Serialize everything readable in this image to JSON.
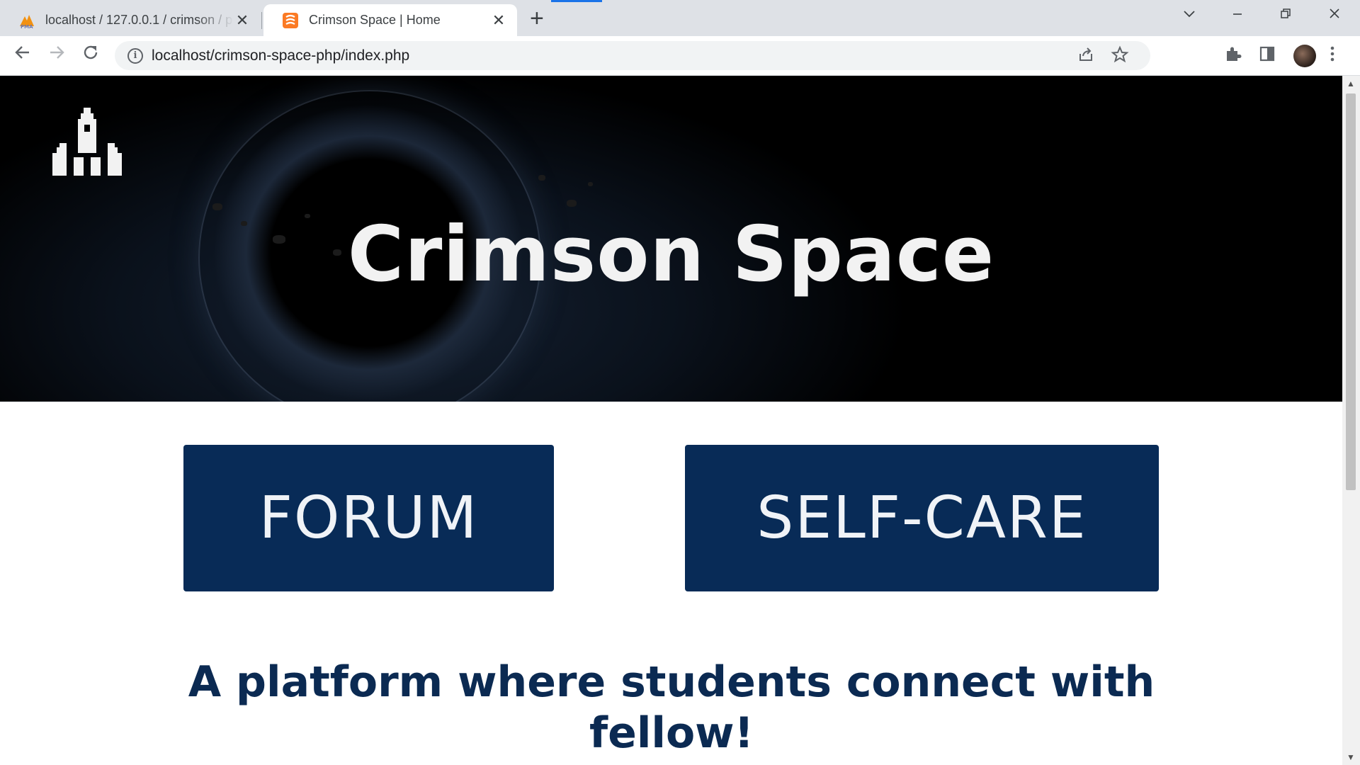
{
  "browser": {
    "tabs": [
      {
        "title": "localhost / 127.0.0.1 / crimson / p",
        "favicon": "phpmyadmin-icon",
        "active": false
      },
      {
        "title": "Crimson Space | Home",
        "favicon": "xampp-icon",
        "active": true
      }
    ],
    "new_tab_label": "+",
    "close_glyph": "✕",
    "url": "localhost/crimson-space-php/index.php",
    "accent": "#1a73e8"
  },
  "page": {
    "hero_title": "Crimson Space",
    "buttons": {
      "forum": "FORUM",
      "selfcare": "SELF-CARE"
    },
    "tagline": "A platform where students connect with fellow!",
    "colors": {
      "button_bg": "#082b57",
      "tagline": "#0b2a52",
      "hero_text": "#f2f2f2"
    },
    "logo": "rocket-icon"
  }
}
